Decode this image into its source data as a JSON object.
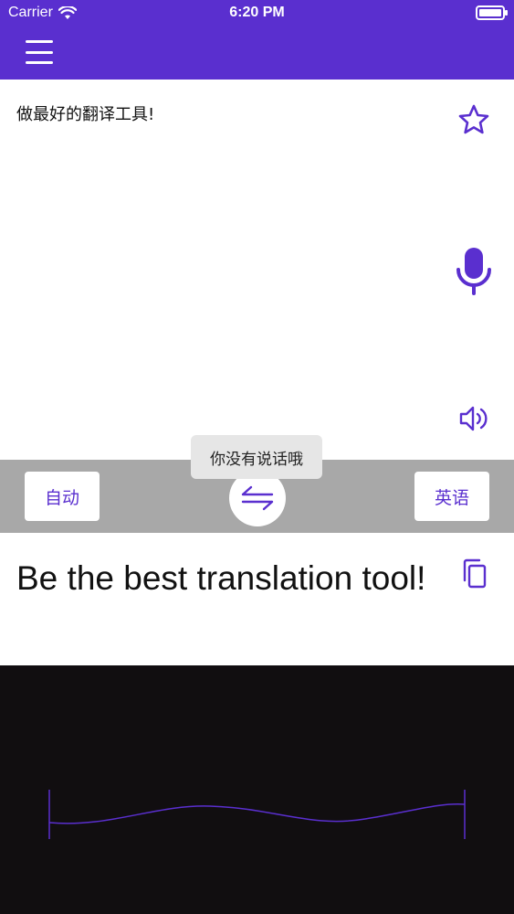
{
  "status_bar": {
    "carrier": "Carrier",
    "time": "6:20 PM",
    "wifi_icon": "wifi-icon",
    "battery_icon": "battery-icon"
  },
  "nav": {
    "menu_icon": "hamburger-menu-icon"
  },
  "source": {
    "text": "做最好的翻译工具!",
    "favorite_icon": "star-icon",
    "mic_icon": "microphone-icon",
    "speaker_icon": "speaker-icon"
  },
  "language_bar": {
    "source_language": "自动",
    "target_language": "英语",
    "swap_icon": "swap-arrows-icon"
  },
  "toast": {
    "message": "你没有说话哦"
  },
  "target": {
    "text": "Be the best translation tool!",
    "copy_icon": "copy-icon"
  },
  "colors": {
    "brand": "#5a2fcf",
    "toolbar_gray": "#a8a8a8",
    "wave_background": "#110e10",
    "wave_line": "#5a2fcf"
  }
}
